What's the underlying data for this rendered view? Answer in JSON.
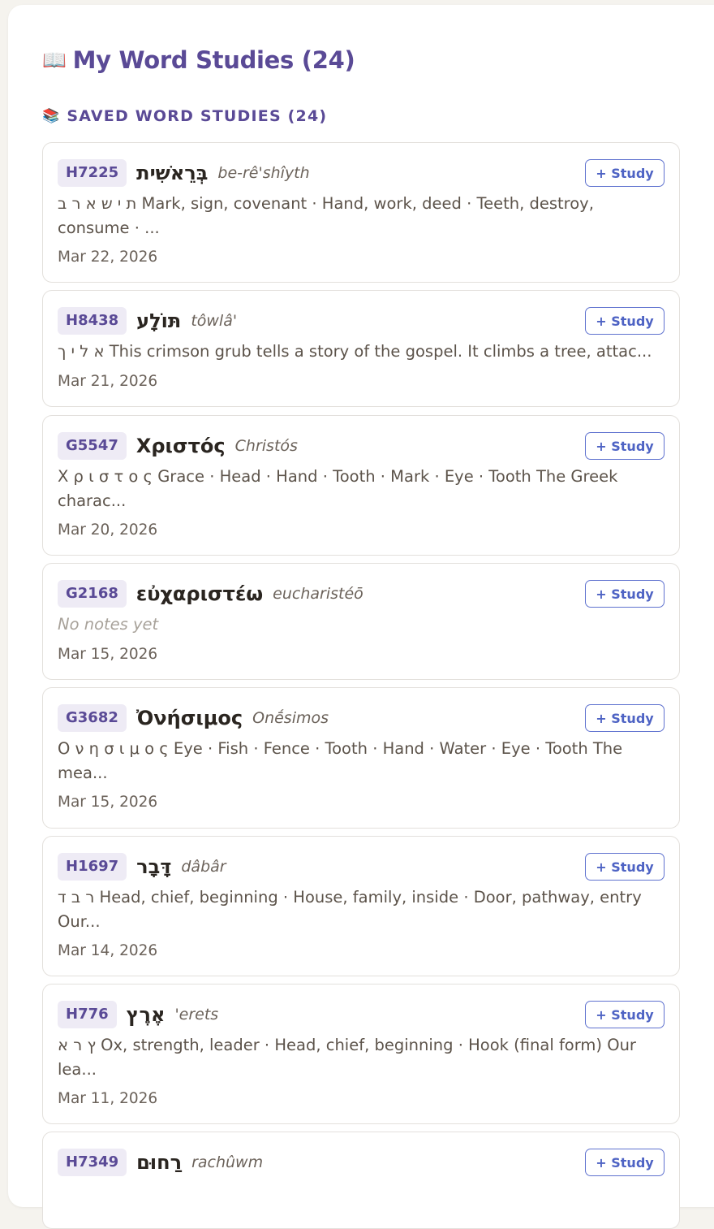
{
  "header": {
    "icon": "open-book-icon",
    "title": "My Word Studies (24)"
  },
  "section": {
    "icon": "books-icon",
    "title": "SAVED WORD STUDIES (24)"
  },
  "study_button_label": "+ Study",
  "colors": {
    "accent": "#5a4a96",
    "button": "#4e63c4",
    "badge_bg": "#eeebf5"
  },
  "studies": [
    {
      "code": "H7225",
      "word": "בְּרֵאשִׁית",
      "rtl": true,
      "translit": "be-rê'shîyth",
      "note": "ת י ש א ר ב Mark, sign, covenant · Hand, work, deed · Teeth, destroy, consume · ...",
      "date": "Mar 22, 2026"
    },
    {
      "code": "H8438",
      "word": "תּוֹלָע",
      "rtl": true,
      "translit": "tôwlâ'",
      "note": "א ל י ך This crimson grub tells a story of the gospel. It climbs a tree, attac...",
      "date": "Mar 21, 2026"
    },
    {
      "code": "G5547",
      "word": "Χριστός",
      "rtl": false,
      "translit": "Christós",
      "note": "Χ ρ ι σ τ ο ς Grace · Head · Hand · Tooth · Mark · Eye · Tooth The Greek charac...",
      "date": "Mar 20, 2026"
    },
    {
      "code": "G2168",
      "word": "εὐχαριστέω",
      "rtl": false,
      "translit": "eucharistéō",
      "note": "No notes yet",
      "empty": true,
      "date": "Mar 15, 2026"
    },
    {
      "code": "G3682",
      "word": "Ὀνήσιμος",
      "rtl": false,
      "translit": "Onḗsimos",
      "note": "Ο ν η σ ι μ ο ς Eye · Fish · Fence · Tooth · Hand · Water · Eye · Tooth The mea...",
      "date": "Mar 15, 2026"
    },
    {
      "code": "H1697",
      "word": "דָּבָר",
      "rtl": true,
      "translit": "dâbâr",
      "note": "ר ב ד Head, chief, beginning · House, family, inside · Door, pathway, entry Our...",
      "date": "Mar 14, 2026"
    },
    {
      "code": "H776",
      "word": "אֶרֶץ",
      "rtl": true,
      "translit": "'erets",
      "note": "ץ ר א Ox, strength, leader · Head, chief, beginning · Hook (final form) Our lea...",
      "date": "Mar 11, 2026"
    },
    {
      "code": "H7349",
      "word": "רַחוּם",
      "rtl": true,
      "translit": "rachûwm",
      "note": "",
      "date": ""
    }
  ]
}
